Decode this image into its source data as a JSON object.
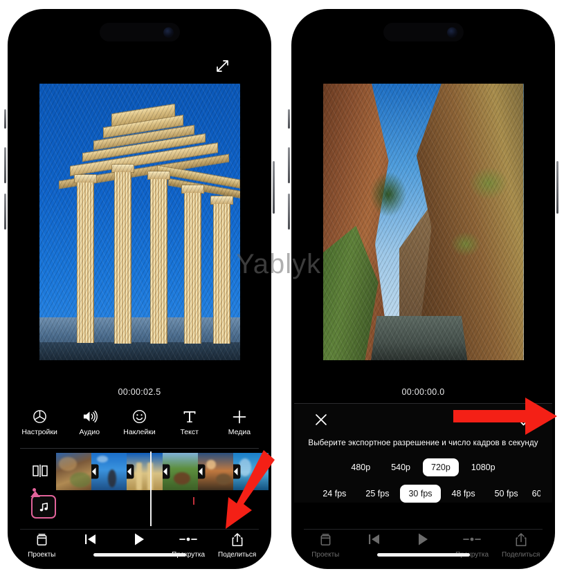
{
  "watermark": "Yablyk",
  "left_phone": {
    "expand_icon": "expand-diagonal-icon",
    "timecode": "00:00:02.5",
    "toolbar": [
      {
        "icon": "settings-aperture-icon",
        "label": "Настройки"
      },
      {
        "icon": "speaker-volume-icon",
        "label": "Аудио"
      },
      {
        "icon": "smiley-sticker-icon",
        "label": "Наклейки"
      },
      {
        "icon": "text-t-icon",
        "label": "Текст"
      },
      {
        "icon": "plus-media-icon",
        "label": "Медиа"
      }
    ],
    "timeline": {
      "split_handle_icon": "split-clip-icon",
      "transition_icon": "transition-icon",
      "clips": 6,
      "transitions": 6,
      "audio_track_icon": "music-note-icon",
      "playhead_position": "00:00:02.5"
    },
    "navbar": [
      {
        "icon": "projects-stack-icon",
        "label": "Проекты"
      },
      {
        "icon": "skip-start-icon",
        "label": ""
      },
      {
        "icon": "play-icon",
        "label": ""
      },
      {
        "icon": "scrub-icon",
        "label": "Прокрутка"
      },
      {
        "icon": "share-icon",
        "label": "Поделиться"
      }
    ]
  },
  "right_phone": {
    "timecode": "00:00:00.0",
    "export_sheet": {
      "close_icon": "close-x-icon",
      "confirm_icon": "checkmark-icon",
      "title": "Выберите экспортное разрешение и число кадров в секунду",
      "resolutions": [
        "480p",
        "540p",
        "720p",
        "1080p"
      ],
      "selected_resolution": "720p",
      "framerates": [
        "24 fps",
        "25 fps",
        "30 fps",
        "48 fps",
        "50 fps",
        "60"
      ],
      "selected_framerate": "30 fps"
    },
    "navbar": [
      {
        "icon": "projects-stack-icon",
        "label": "Проекты"
      },
      {
        "icon": "skip-start-icon",
        "label": ""
      },
      {
        "icon": "play-icon",
        "label": ""
      },
      {
        "icon": "scrub-icon",
        "label": "Прокрутка"
      },
      {
        "icon": "share-icon",
        "label": "Поделиться"
      }
    ]
  },
  "annotations": {
    "arrow_color": "#f42016",
    "arrow_left_target": "Поделиться",
    "arrow_right_target": "checkmark-icon"
  }
}
